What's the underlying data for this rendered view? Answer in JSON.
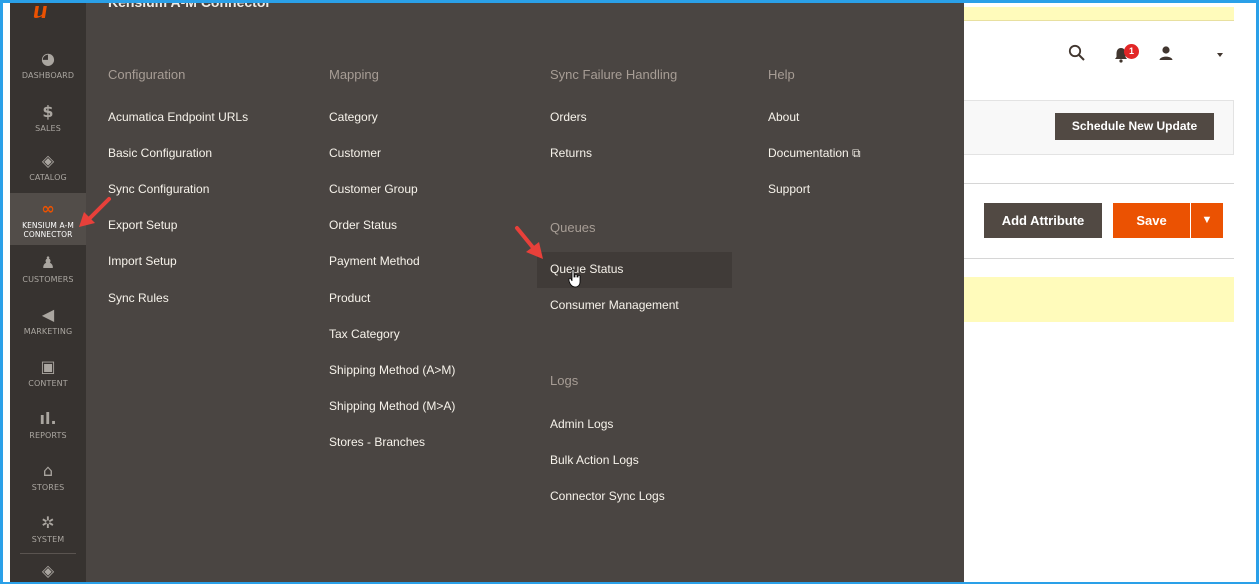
{
  "nav": {
    "items": [
      {
        "label": "DASHBOARD",
        "icon": "dashboard-icon",
        "glyph": "◕"
      },
      {
        "label": "SALES",
        "icon": "dollar-icon",
        "glyph": "$"
      },
      {
        "label": "CATALOG",
        "icon": "cube-icon",
        "glyph": "◈"
      },
      {
        "label": "KENSIUM A-M CONNECTOR",
        "icon": "connector-icon",
        "glyph": "∞"
      },
      {
        "label": "CUSTOMERS",
        "icon": "person-icon",
        "glyph": "♟"
      },
      {
        "label": "MARKETING",
        "icon": "megaphone-icon",
        "glyph": "◀"
      },
      {
        "label": "CONTENT",
        "icon": "content-icon",
        "glyph": "▣"
      },
      {
        "label": "REPORTS",
        "icon": "bar-chart-icon",
        "glyph": "ıl."
      },
      {
        "label": "STORES",
        "icon": "store-icon",
        "glyph": "⌂"
      },
      {
        "label": "SYSTEM",
        "icon": "gear-icon",
        "glyph": "✲"
      },
      {
        "label": "",
        "icon": "partners-icon",
        "glyph": "◈"
      }
    ]
  },
  "flyout": {
    "title": "Kensium A-M Connector",
    "columns": [
      {
        "heading": "Configuration",
        "items": [
          "Acumatica Endpoint URLs",
          "Basic Configuration",
          "Sync Configuration",
          "Export Setup",
          "Import Setup",
          "Sync Rules"
        ]
      },
      {
        "heading": "Mapping",
        "items": [
          "Category",
          "Customer",
          "Customer Group",
          "Order Status",
          "Payment Method",
          "Product",
          "Tax Category",
          "Shipping Method (A>M)",
          "Shipping Method (M>A)",
          "Stores - Branches"
        ]
      },
      {
        "heading": "Sync Failure Handling",
        "items": [
          "Orders",
          "Returns"
        ],
        "heading2": "Queues",
        "items2": [
          "Queue Status",
          "Consumer Management"
        ],
        "heading3": "Logs",
        "items3": [
          "Admin Logs",
          "Bulk Action Logs",
          "Connector Sync Logs"
        ]
      },
      {
        "heading": "Help",
        "items": [
          "About",
          "Documentation ⧉",
          "Support"
        ]
      }
    ]
  },
  "header": {
    "notification_count": "1"
  },
  "page": {
    "schedule_button": "Schedule New Update",
    "add_attribute_button": "Add Attribute",
    "save_button": "Save",
    "save_dropdown": "▼"
  },
  "colors": {
    "accent": "#eb5202",
    "nav_bg": "#373330",
    "flyout_bg": "#4a4542",
    "annotation_arrow": "#e8403a",
    "frame_border": "#2aa0e8"
  }
}
